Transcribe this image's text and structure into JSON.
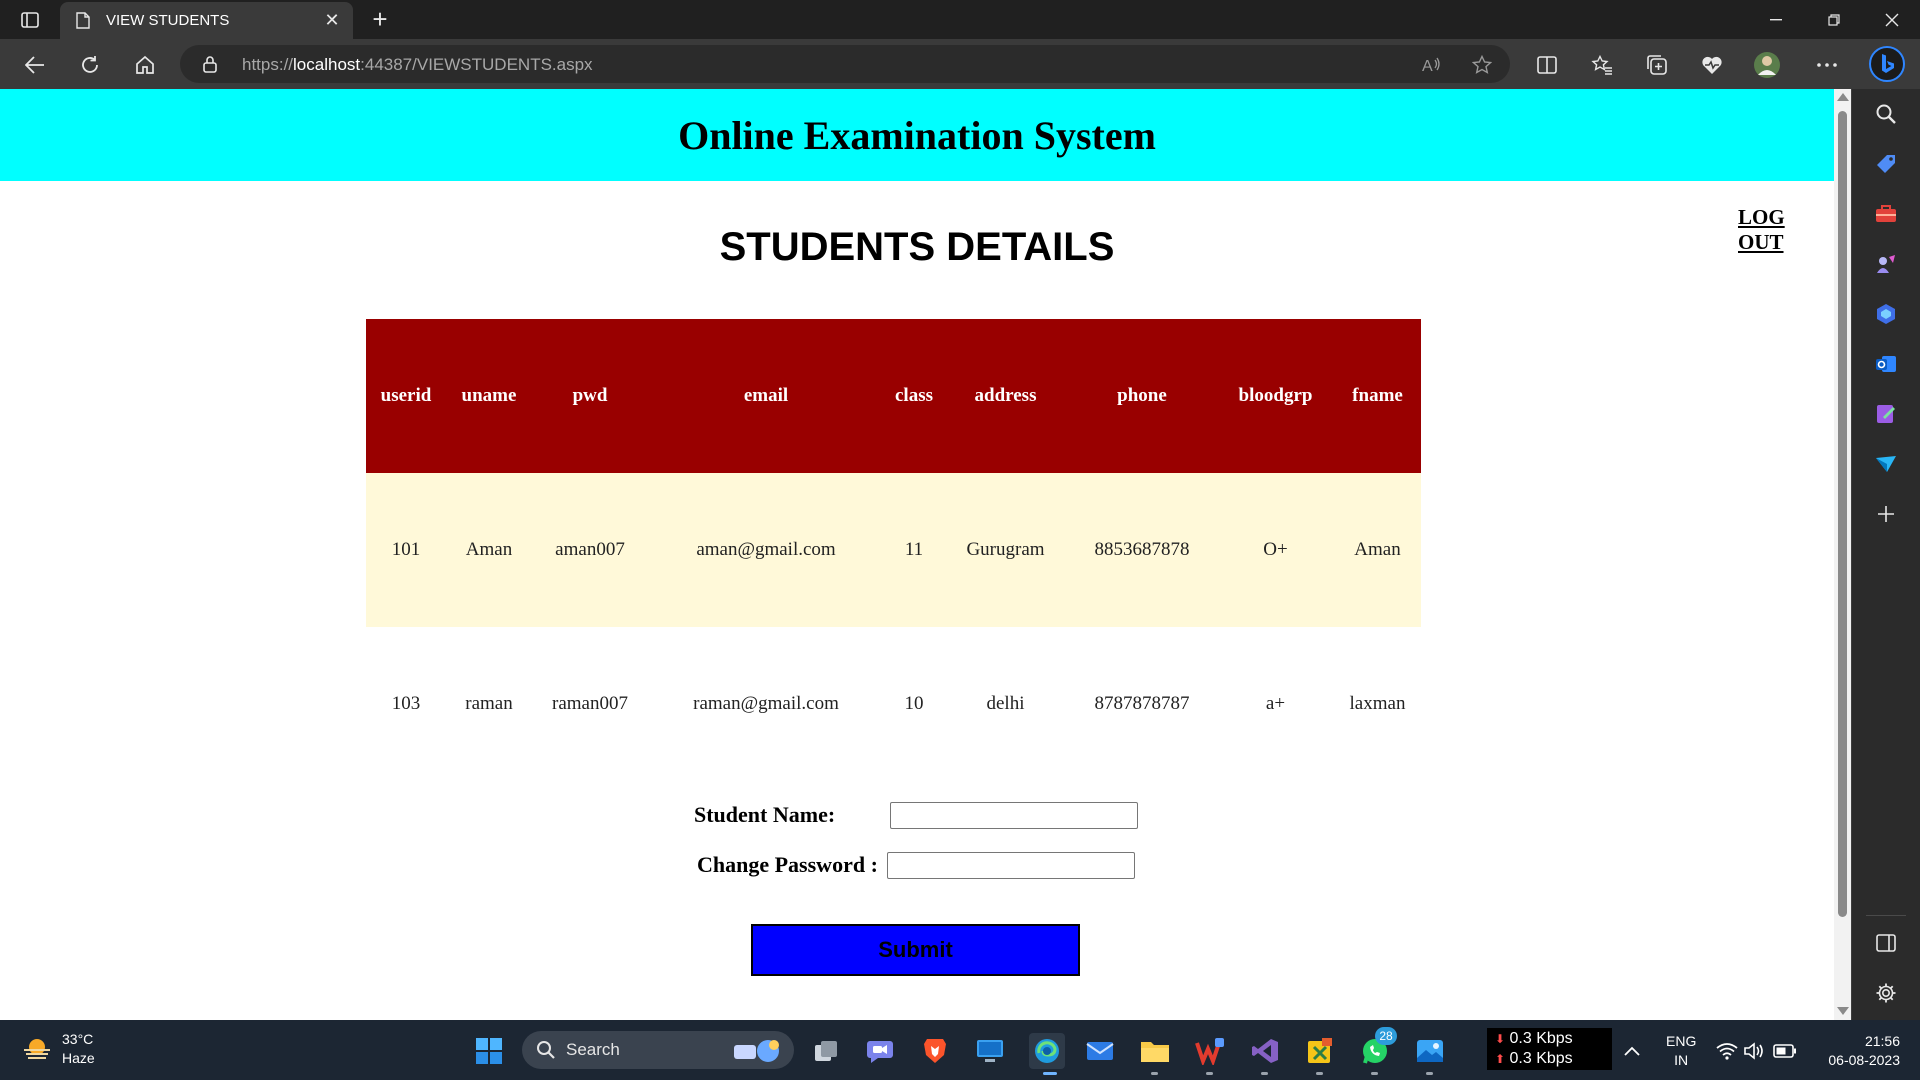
{
  "browser": {
    "tab_title": "VIEW STUDENTS",
    "url_scheme": "https://",
    "url_host": "localhost",
    "url_rest": ":44387/VIEWSTUDENTS.aspx"
  },
  "site": {
    "title": "Online Examination System",
    "logout_label": "LOG OUT",
    "heading": "STUDENTS DETAILS"
  },
  "table": {
    "columns": [
      "userid",
      "uname",
      "pwd",
      "email",
      "class",
      "address",
      "phone",
      "bloodgrp",
      "fname"
    ],
    "rows": [
      [
        "101",
        "Aman",
        "aman007",
        "aman@gmail.com",
        "11",
        "Gurugram",
        "8853687878",
        "O+",
        "Aman"
      ],
      [
        "103",
        "raman",
        "raman007",
        "raman@gmail.com",
        "10",
        "delhi",
        "8787878787",
        "a+",
        "laxman"
      ]
    ],
    "header_color": "#990000",
    "alt_row_color": "#fff9d9"
  },
  "form": {
    "student_name_label": "Student Name:",
    "student_name_value": "",
    "change_password_label": "Change Password :",
    "change_password_value": "",
    "submit_label": "Submit",
    "submit_color": "#0000ff"
  },
  "colors": {
    "header_bg": "#00ffff"
  },
  "taskbar": {
    "weather_temp": "33°C",
    "weather_desc": "Haze",
    "search_label": "Search",
    "whatsapp_badge": "28",
    "net_down": "0.3 Kbps",
    "net_up": "0.3 Kbps",
    "lang_1": "ENG",
    "lang_2": "IN",
    "time": "21:56",
    "date": "06-08-2023"
  }
}
